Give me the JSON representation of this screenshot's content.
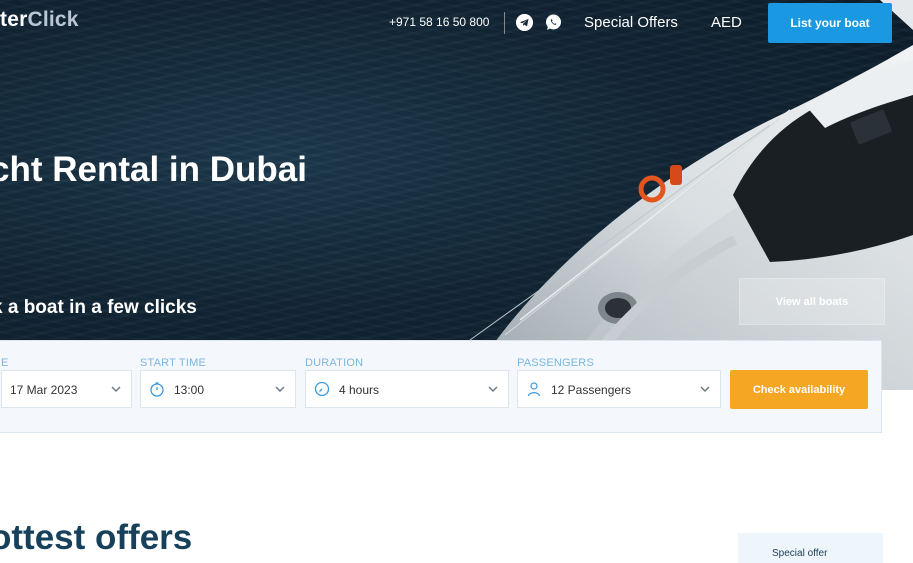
{
  "header": {
    "logo_main": "ter",
    "logo_accent": "Click",
    "phone": "+971 58 16 50 800",
    "nav_offers": "Special Offers",
    "nav_currency": "AED",
    "list_boat_label": "List your boat",
    "icons": [
      "telegram-icon",
      "whatsapp-icon"
    ]
  },
  "hero": {
    "title": "cht Rental in Dubai",
    "subtitle": "k a boat in a few clicks",
    "view_all_label": "View all boats"
  },
  "search": {
    "date": {
      "label": "E",
      "value": "17 Mar 2023"
    },
    "start_time": {
      "label": "START TIME",
      "value": "13:00"
    },
    "duration": {
      "label": "DURATION",
      "value": "4 hours"
    },
    "passengers": {
      "label": "PASSENGERS",
      "value": "12 Passengers"
    },
    "check_label": "Check availability"
  },
  "offers": {
    "title": "ottest offers",
    "card_partial": "Special offer"
  },
  "colors": {
    "primary_blue": "#1a99e2",
    "accent_orange": "#f5a623",
    "heading_navy": "#17405b",
    "label_blue": "#7bb6df"
  }
}
